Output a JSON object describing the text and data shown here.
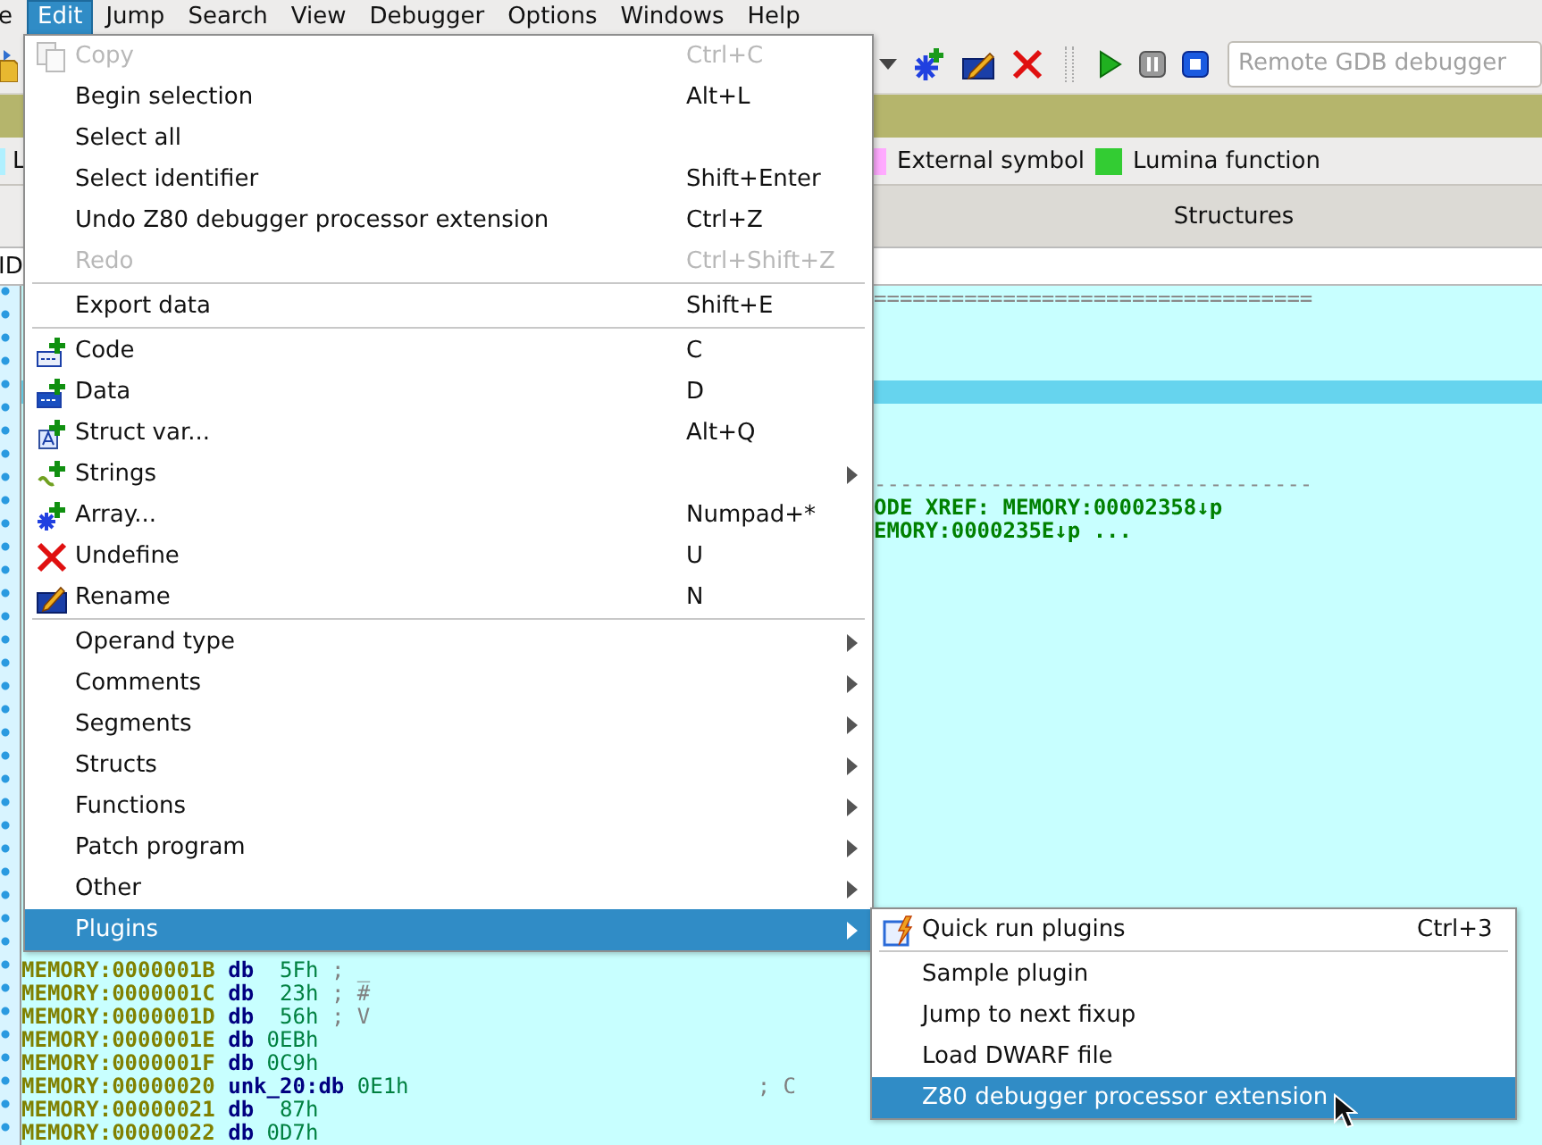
{
  "menubar": [
    {
      "label": "e",
      "selected": false
    },
    {
      "label": "Edit",
      "selected": true
    },
    {
      "label": "Jump",
      "selected": false
    },
    {
      "label": "Search",
      "selected": false
    },
    {
      "label": "View",
      "selected": false
    },
    {
      "label": "Debugger",
      "selected": false
    },
    {
      "label": "Options",
      "selected": false
    },
    {
      "label": "Windows",
      "selected": false
    },
    {
      "label": "Help",
      "selected": false
    }
  ],
  "toolbar": {
    "debugger_combo": {
      "value": "Remote GDB debugger",
      "disabled": true
    }
  },
  "legend": [
    {
      "label": "L",
      "color": "#b0f0ff"
    },
    {
      "label": "External symbol",
      "color": "#ffaaff"
    },
    {
      "label": "Lumina function",
      "color": "#33cc33"
    }
  ],
  "tabs": [
    {
      "label": "Structures",
      "selected": false
    }
  ],
  "pane_tab": "ID",
  "disassembly": {
    "top_lines": [
      {
        "kind": "rule",
        "text": "=================================="
      },
      {
        "kind": "blank"
      },
      {
        "kind": "blank"
      },
      {
        "kind": "blank"
      },
      {
        "kind": "cursor_band"
      },
      {
        "kind": "blank"
      },
      {
        "kind": "blank"
      },
      {
        "kind": "blank"
      },
      {
        "kind": "rule",
        "text": "----------------------------------"
      },
      {
        "kind": "xref",
        "text": "ODE XREF: MEMORY:00002358↓p"
      },
      {
        "kind": "xref",
        "text": "EMORY:0000235E↓p ..."
      }
    ],
    "bottom_lines": [
      {
        "address": "MEMORY:0000001B",
        "mnemonic": "db",
        "operand": "5Fh",
        "comment": "; _"
      },
      {
        "address": "MEMORY:0000001C",
        "mnemonic": "db",
        "operand": "23h",
        "comment": "; #"
      },
      {
        "address": "MEMORY:0000001D",
        "mnemonic": "db",
        "operand": "56h",
        "comment": "; V"
      },
      {
        "address": "MEMORY:0000001E",
        "mnemonic": "db",
        "operand": "0EBh"
      },
      {
        "address": "MEMORY:0000001F",
        "mnemonic": "db",
        "operand": "0C9h"
      },
      {
        "address": "MEMORY:00000020",
        "label": "unk_20:",
        "mnemonic": "db",
        "operand": "0E1h",
        "comment": "; C"
      },
      {
        "address": "MEMORY:00000021",
        "mnemonic": "db",
        "operand": "87h"
      },
      {
        "address": "MEMORY:00000022",
        "mnemonic": "db",
        "operand": "0D7h"
      }
    ]
  },
  "edit_menu": [
    {
      "kind": "item",
      "label": "Copy",
      "shortcut": "Ctrl+C",
      "disabled": true,
      "submenu": false,
      "selected": false
    },
    {
      "kind": "item",
      "label": "Begin selection",
      "shortcut": "Alt+L",
      "disabled": false,
      "submenu": false,
      "selected": false
    },
    {
      "kind": "item",
      "label": "Select all",
      "disabled": false,
      "submenu": false,
      "selected": false
    },
    {
      "kind": "item",
      "label": "Select identifier",
      "shortcut": "Shift+Enter",
      "disabled": false,
      "submenu": false,
      "selected": false
    },
    {
      "kind": "item",
      "label": "Undo Z80 debugger processor extension",
      "shortcut": "Ctrl+Z",
      "disabled": false,
      "submenu": false,
      "selected": false
    },
    {
      "kind": "item",
      "label": "Redo",
      "shortcut": "Ctrl+Shift+Z",
      "disabled": true,
      "submenu": false,
      "selected": false
    },
    {
      "kind": "separator"
    },
    {
      "kind": "item",
      "label": "Export data",
      "shortcut": "Shift+E",
      "disabled": false,
      "submenu": false,
      "selected": false
    },
    {
      "kind": "separator"
    },
    {
      "kind": "item",
      "label": "Code",
      "shortcut": "C",
      "disabled": false,
      "submenu": false,
      "selected": false
    },
    {
      "kind": "item",
      "label": "Data",
      "shortcut": "D",
      "disabled": false,
      "submenu": false,
      "selected": false
    },
    {
      "kind": "item",
      "label": "Struct var...",
      "shortcut": "Alt+Q",
      "disabled": false,
      "submenu": false,
      "selected": false
    },
    {
      "kind": "item",
      "label": "Strings",
      "disabled": false,
      "submenu": true,
      "selected": false
    },
    {
      "kind": "item",
      "label": "Array...",
      "shortcut": "Numpad+*",
      "disabled": false,
      "submenu": false,
      "selected": false
    },
    {
      "kind": "item",
      "label": "Undefine",
      "shortcut": "U",
      "disabled": false,
      "submenu": false,
      "selected": false
    },
    {
      "kind": "item",
      "label": "Rename",
      "shortcut": "N",
      "disabled": false,
      "submenu": false,
      "selected": false
    },
    {
      "kind": "separator"
    },
    {
      "kind": "item",
      "label": "Operand type",
      "disabled": false,
      "submenu": true,
      "selected": false
    },
    {
      "kind": "item",
      "label": "Comments",
      "disabled": false,
      "submenu": true,
      "selected": false
    },
    {
      "kind": "item",
      "label": "Segments",
      "disabled": false,
      "submenu": true,
      "selected": false
    },
    {
      "kind": "item",
      "label": "Structs",
      "disabled": false,
      "submenu": true,
      "selected": false
    },
    {
      "kind": "item",
      "label": "Functions",
      "disabled": false,
      "submenu": true,
      "selected": false
    },
    {
      "kind": "item",
      "label": "Patch program",
      "disabled": false,
      "submenu": true,
      "selected": false
    },
    {
      "kind": "item",
      "label": "Other",
      "disabled": false,
      "submenu": true,
      "selected": false
    },
    {
      "kind": "item",
      "label": "Plugins",
      "disabled": false,
      "submenu": true,
      "selected": true
    }
  ],
  "plugins_menu": [
    {
      "kind": "item",
      "label": "Quick run plugins",
      "shortcut": "Ctrl+3",
      "selected": false
    },
    {
      "kind": "separator"
    },
    {
      "kind": "item",
      "label": "Sample plugin",
      "selected": false
    },
    {
      "kind": "item",
      "label": "Jump to next fixup",
      "selected": false
    },
    {
      "kind": "item",
      "label": "Load DWARF file",
      "selected": false
    },
    {
      "kind": "item",
      "label": "Z80 debugger processor extension",
      "selected": true
    }
  ]
}
